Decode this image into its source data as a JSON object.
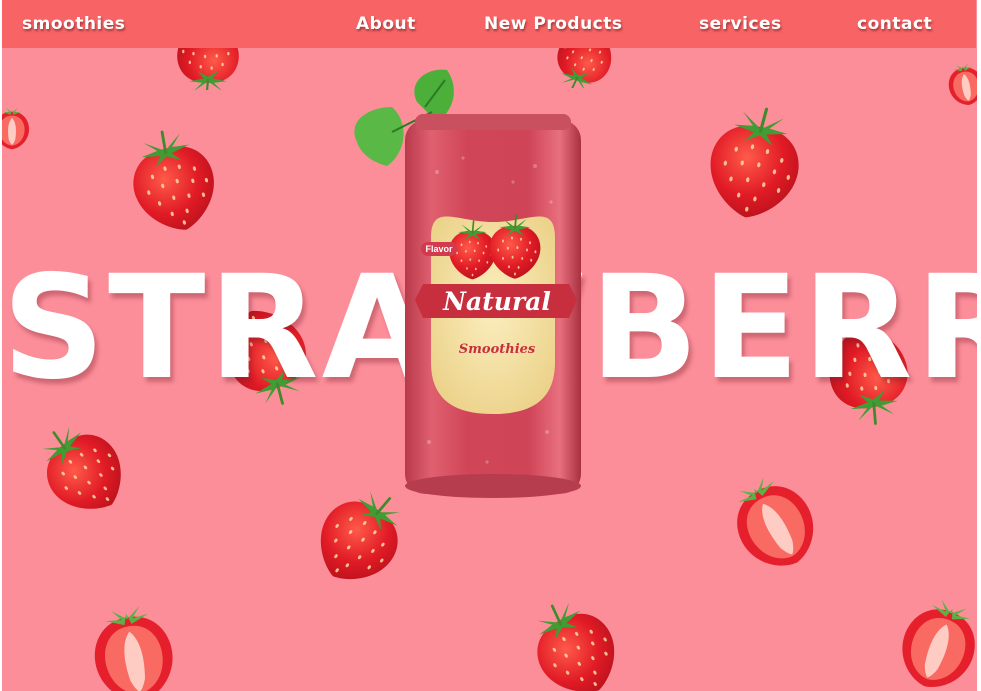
{
  "nav": {
    "brand": "smoothies",
    "links": [
      "About",
      "New Products",
      "services",
      "contact"
    ]
  },
  "hero": {
    "title": "STRAWBERRY",
    "can": {
      "flavor_tag": "Flavor",
      "banner_text": "Natural",
      "sub_text": "Smoothies"
    }
  },
  "colors": {
    "nav_bar": "#F86466",
    "background": "#FC8E9A",
    "can_red": "#D5495C",
    "label_cream": "#F4E0A0",
    "banner_red": "#C82F3E",
    "strawberry": "#E01A25",
    "leaf": "#4CAF3A"
  },
  "icons": {
    "decoration": "strawberry-icon",
    "product": "soda-can-icon"
  }
}
